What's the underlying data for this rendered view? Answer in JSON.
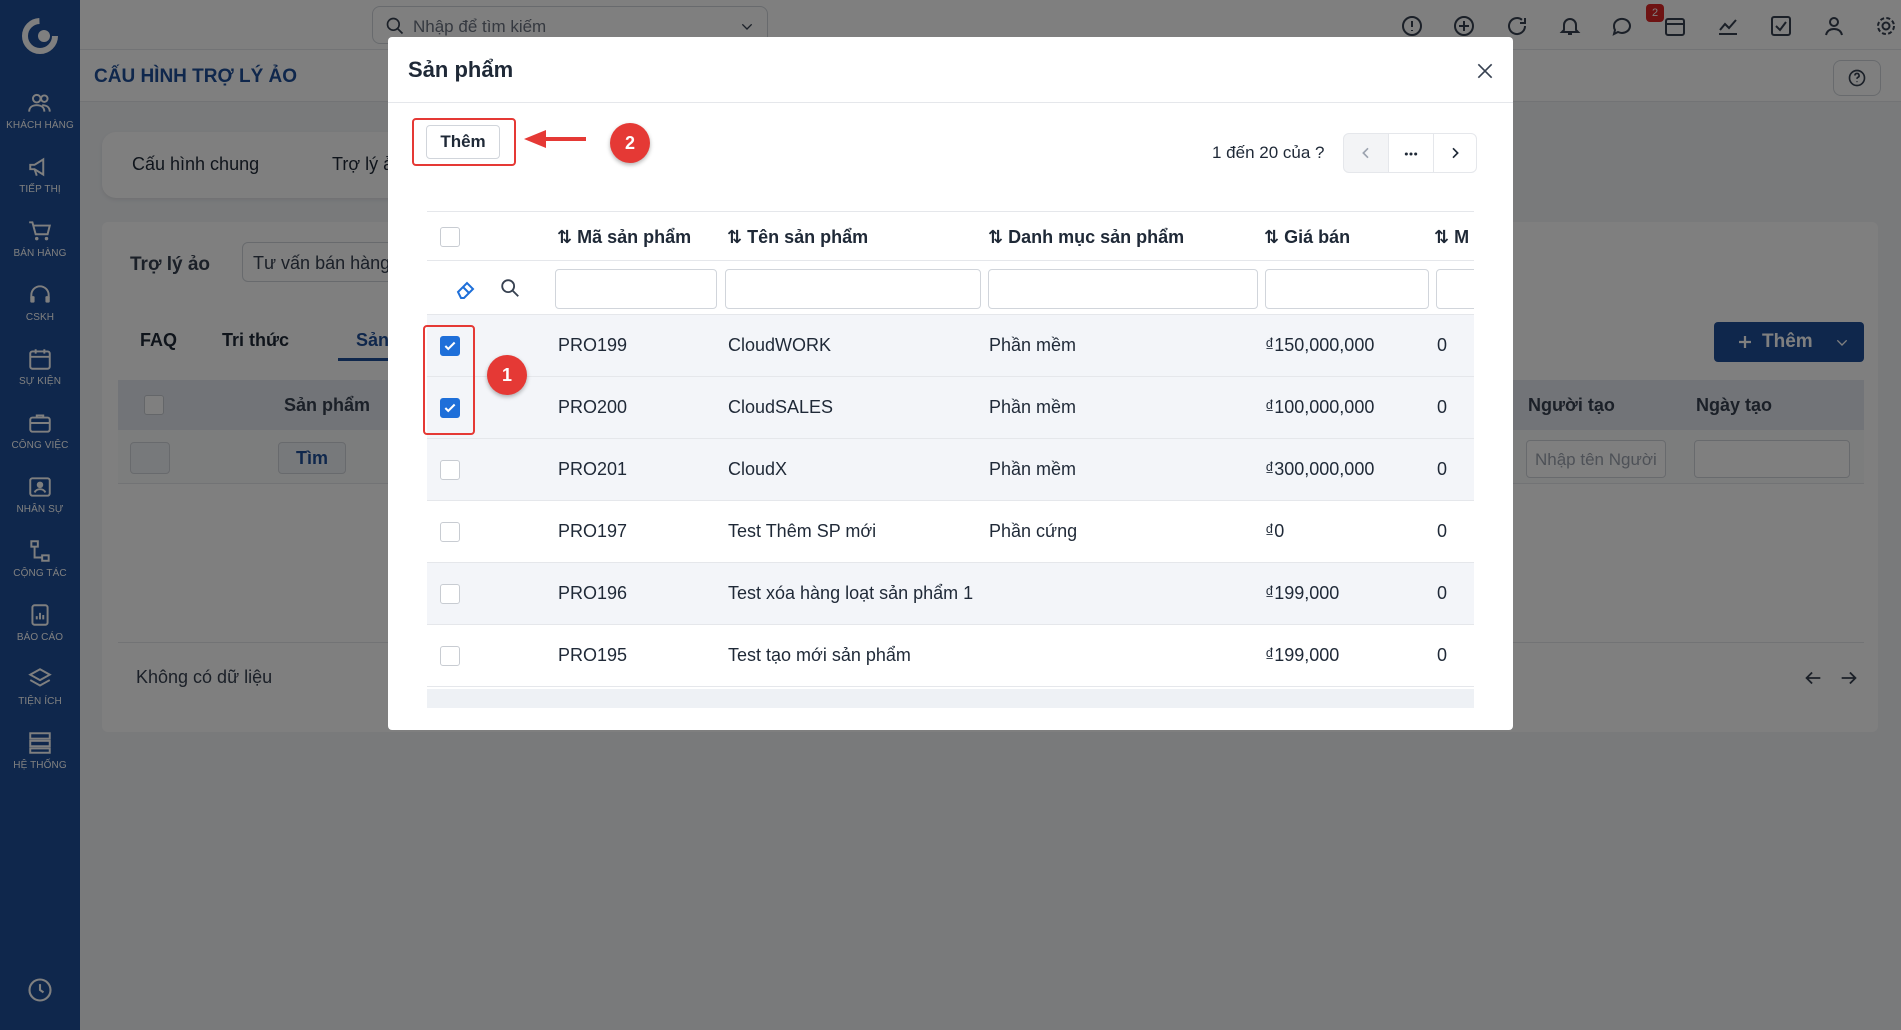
{
  "sidebar": {
    "items": [
      {
        "label": "KHÁCH HÀNG",
        "icon": "users-icon"
      },
      {
        "label": "TIẾP THỊ",
        "icon": "megaphone-icon"
      },
      {
        "label": "BÁN HÀNG",
        "icon": "cart-icon"
      },
      {
        "label": "CSKH",
        "icon": "headset-icon"
      },
      {
        "label": "SỰ KIỆN",
        "icon": "calendar-icon"
      },
      {
        "label": "CÔNG VIỆC",
        "icon": "briefcase-icon"
      },
      {
        "label": "NHÂN SỰ",
        "icon": "id-card-icon"
      },
      {
        "label": "CỘNG TÁC",
        "icon": "network-icon"
      },
      {
        "label": "BÁO CÁO",
        "icon": "report-icon"
      },
      {
        "label": "TIỆN ÍCH",
        "icon": "layers-icon"
      },
      {
        "label": "HỆ THỐNG",
        "icon": "server-icon"
      }
    ]
  },
  "topbar": {
    "search_placeholder": "Nhập để tìm kiếm",
    "notification_count": "2"
  },
  "page": {
    "title": "CẤU HÌNH TRỢ LÝ ẢO"
  },
  "tabs": [
    "Cấu hình chung",
    "Trợ lý ảo"
  ],
  "content": {
    "assistant_label": "Trợ lý ảo",
    "assistant_value": "Tư vấn bán hàng",
    "subtabs": [
      "FAQ",
      "Tri thức",
      "Sản phẩm"
    ],
    "add_button": "Thêm",
    "columns": [
      "Sản phẩm",
      "Người tạo",
      "Ngày tạo"
    ],
    "find_button": "Tìm",
    "creator_placeholder": "Nhập tên Người tạo",
    "no_data": "Không có dữ liệu"
  },
  "modal": {
    "title": "Sản phẩm",
    "add_button": "Thêm",
    "pager_text": "1 đến 20 của ?",
    "columns": [
      "Mã sản phẩm",
      "Tên sản phẩm",
      "Danh mục sản phẩm",
      "Giá bán",
      "M"
    ],
    "rows": [
      {
        "code": "PRO199",
        "name": "CloudWORK",
        "category": "Phần mềm",
        "price": "₫150,000,000",
        "m": "0",
        "checked": true
      },
      {
        "code": "PRO200",
        "name": "CloudSALES",
        "category": "Phần mềm",
        "price": "₫100,000,000",
        "m": "0",
        "checked": true
      },
      {
        "code": "PRO201",
        "name": "CloudX",
        "category": "Phần mềm",
        "price": "₫300,000,000",
        "m": "0",
        "checked": false
      },
      {
        "code": "PRO197",
        "name": "Test Thêm SP mới",
        "category": "Phần cứng",
        "price": "₫0",
        "m": "0",
        "checked": false
      },
      {
        "code": "PRO196",
        "name": "Test xóa hàng loạt sản phẩm 1",
        "category": "",
        "price": "₫199,000",
        "m": "0",
        "checked": false
      },
      {
        "code": "PRO195",
        "name": "Test tạo mới sản phẩm",
        "category": "",
        "price": "₫199,000",
        "m": "0",
        "checked": false
      }
    ]
  },
  "annotations": {
    "step1": "1",
    "step2": "2",
    "highlight_color": "#e53935"
  }
}
